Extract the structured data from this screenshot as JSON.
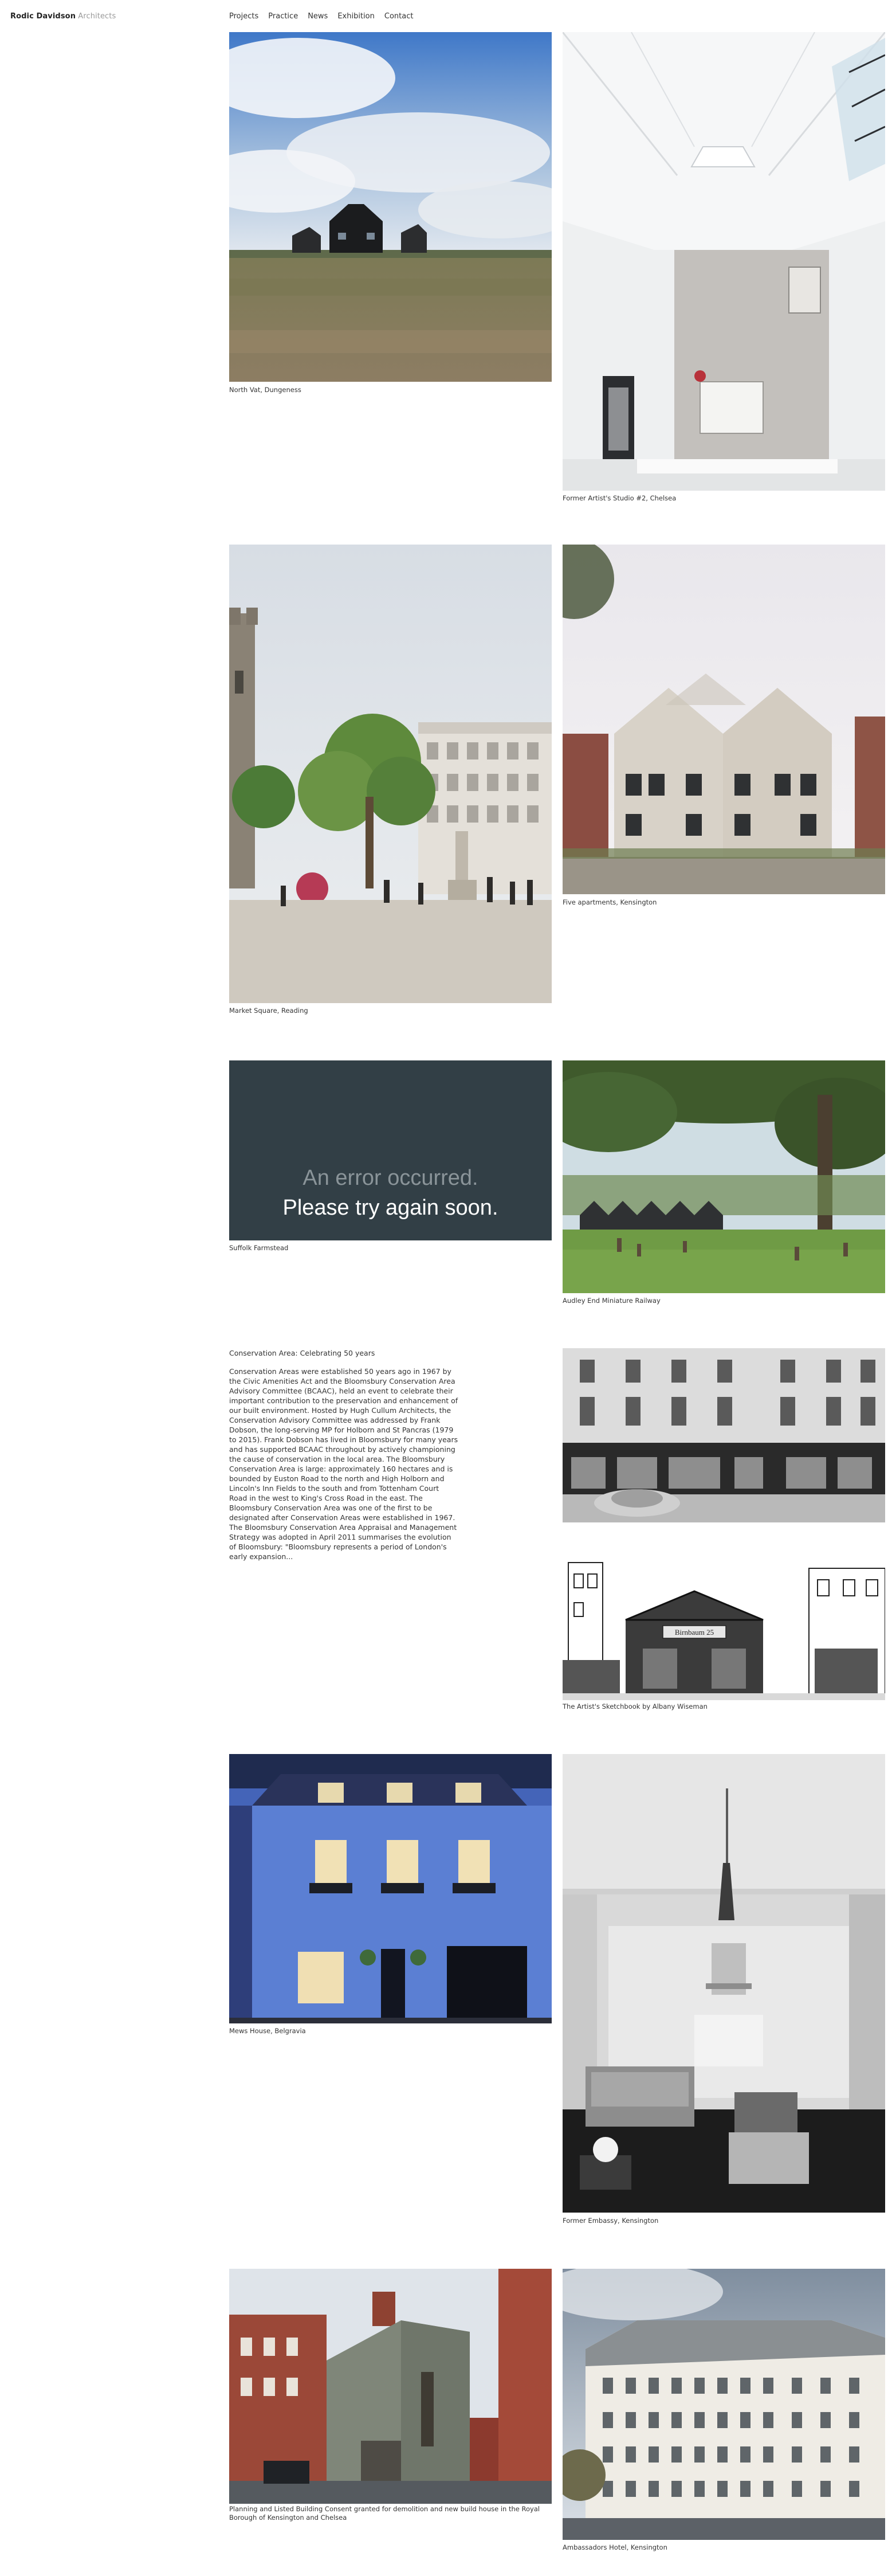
{
  "header": {
    "brand": "Rodic Davidson",
    "brand_sub": "Architects",
    "nav": [
      "Projects",
      "Practice",
      "News",
      "Exhibition",
      "Contact"
    ]
  },
  "projects": [
    {
      "caption": "North Vat, Dungeness"
    },
    {
      "caption": "Former Artist's Studio #2, Chelsea"
    },
    {
      "caption": "Market Square, Reading"
    },
    {
      "caption": "Five apartments, Kensington"
    },
    {
      "caption": "Suffolk Farmstead"
    },
    {
      "caption": "Audley End Miniature Railway"
    },
    {
      "caption": "The Artist's Sketchbook by Albany Wiseman"
    },
    {
      "caption": "Mews House, Belgravia"
    },
    {
      "caption": "Former Embassy, Kensington"
    },
    {
      "caption": "Planning and Listed Building Consent granted for demolition and new build house in the Royal Borough of Kensington and Chelsea"
    },
    {
      "caption": "Ambassadors Hotel, Kensington"
    }
  ],
  "video_error": {
    "line1": "An error occurred.",
    "line2": "Please try again soon."
  },
  "news": {
    "title": "Conservation Area: Celebrating 50 years",
    "body": "Conservation Areas were established 50 years ago in 1967 by the Civic Amenities Act and the Bloomsbury Conservation Area Advisory Committee (BCAAC), held an event to celebrate their important contribution to the preservation and enhancement of our built environment. Hosted by Hugh Cullum Architects, the Conservation Advisory Committee was addressed by Frank Dobson, the long-serving MP for Holborn and St Pancras (1979 to 2015). Frank Dobson has lived in Bloomsbury for many years and has supported BCAAC throughout by actively championing the cause of conservation in the local area. The Bloomsbury Conservation Area is large: approximately 160 hectares and is bounded by Euston Road to the north and High Holborn and Lincoln's Inn Fields to the south and from Tottenham Court Road in the west to King's Cross Road in the east. The Bloomsbury Conservation Area was one of the first to be designated after Conservation Areas were established in 1967. The Bloomsbury Conservation Area Appraisal and Management Strategy was adopted in April 2011 summarises the evolution of Bloomsbury: \"Bloomsbury represents a period of London's early expansion..."
  },
  "sketch_shop_sign": "Birnbaum 25"
}
